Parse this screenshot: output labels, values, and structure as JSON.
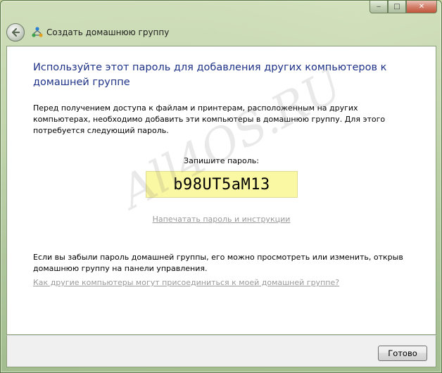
{
  "window": {
    "title": "Создать домашнюю группу",
    "caption_buttons": {
      "minimize": "‒",
      "maximize": "□",
      "close": "✕"
    }
  },
  "main": {
    "heading": "Используйте этот пароль для добавления других компьютеров к домашней группе",
    "description": "Перед получением доступа к файлам и принтерам, расположенным на других компьютерах, необходимо добавить эти компьютеры в домашнюю группу. Для этого потребуется следующий пароль.",
    "password_label": "Запишите пароль:",
    "password": "b98UT5aM13",
    "print_link": "Напечатать пароль и инструкции",
    "footer_note": "Если вы забыли пароль домашней группы, его можно просмотреть или изменить, открыв домашнюю группу на панели управления.",
    "help_link": "Как другие компьютеры могут присоединиться к моей домашней группе?",
    "watermark": "All4OS.RU"
  },
  "buttons": {
    "done": "Готово"
  },
  "colors": {
    "heading": "#1e3287",
    "password_bg": "#fbf8a3",
    "link": "#9a9a9a"
  }
}
